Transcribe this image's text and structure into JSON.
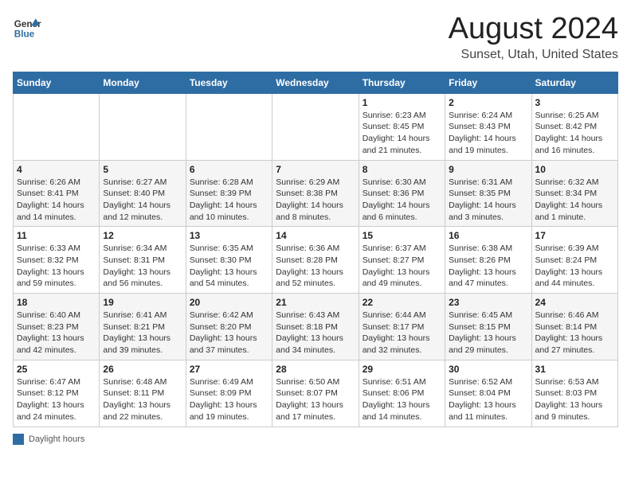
{
  "header": {
    "logo_general": "General",
    "logo_blue": "Blue",
    "title": "August 2024",
    "subtitle": "Sunset, Utah, United States"
  },
  "weekdays": [
    "Sunday",
    "Monday",
    "Tuesday",
    "Wednesday",
    "Thursday",
    "Friday",
    "Saturday"
  ],
  "legend": "Daylight hours",
  "weeks": [
    [
      {
        "day": "",
        "info": ""
      },
      {
        "day": "",
        "info": ""
      },
      {
        "day": "",
        "info": ""
      },
      {
        "day": "",
        "info": ""
      },
      {
        "day": "1",
        "info": "Sunrise: 6:23 AM\nSunset: 8:45 PM\nDaylight: 14 hours\nand 21 minutes."
      },
      {
        "day": "2",
        "info": "Sunrise: 6:24 AM\nSunset: 8:43 PM\nDaylight: 14 hours\nand 19 minutes."
      },
      {
        "day": "3",
        "info": "Sunrise: 6:25 AM\nSunset: 8:42 PM\nDaylight: 14 hours\nand 16 minutes."
      }
    ],
    [
      {
        "day": "4",
        "info": "Sunrise: 6:26 AM\nSunset: 8:41 PM\nDaylight: 14 hours\nand 14 minutes."
      },
      {
        "day": "5",
        "info": "Sunrise: 6:27 AM\nSunset: 8:40 PM\nDaylight: 14 hours\nand 12 minutes."
      },
      {
        "day": "6",
        "info": "Sunrise: 6:28 AM\nSunset: 8:39 PM\nDaylight: 14 hours\nand 10 minutes."
      },
      {
        "day": "7",
        "info": "Sunrise: 6:29 AM\nSunset: 8:38 PM\nDaylight: 14 hours\nand 8 minutes."
      },
      {
        "day": "8",
        "info": "Sunrise: 6:30 AM\nSunset: 8:36 PM\nDaylight: 14 hours\nand 6 minutes."
      },
      {
        "day": "9",
        "info": "Sunrise: 6:31 AM\nSunset: 8:35 PM\nDaylight: 14 hours\nand 3 minutes."
      },
      {
        "day": "10",
        "info": "Sunrise: 6:32 AM\nSunset: 8:34 PM\nDaylight: 14 hours\nand 1 minute."
      }
    ],
    [
      {
        "day": "11",
        "info": "Sunrise: 6:33 AM\nSunset: 8:32 PM\nDaylight: 13 hours\nand 59 minutes."
      },
      {
        "day": "12",
        "info": "Sunrise: 6:34 AM\nSunset: 8:31 PM\nDaylight: 13 hours\nand 56 minutes."
      },
      {
        "day": "13",
        "info": "Sunrise: 6:35 AM\nSunset: 8:30 PM\nDaylight: 13 hours\nand 54 minutes."
      },
      {
        "day": "14",
        "info": "Sunrise: 6:36 AM\nSunset: 8:28 PM\nDaylight: 13 hours\nand 52 minutes."
      },
      {
        "day": "15",
        "info": "Sunrise: 6:37 AM\nSunset: 8:27 PM\nDaylight: 13 hours\nand 49 minutes."
      },
      {
        "day": "16",
        "info": "Sunrise: 6:38 AM\nSunset: 8:26 PM\nDaylight: 13 hours\nand 47 minutes."
      },
      {
        "day": "17",
        "info": "Sunrise: 6:39 AM\nSunset: 8:24 PM\nDaylight: 13 hours\nand 44 minutes."
      }
    ],
    [
      {
        "day": "18",
        "info": "Sunrise: 6:40 AM\nSunset: 8:23 PM\nDaylight: 13 hours\nand 42 minutes."
      },
      {
        "day": "19",
        "info": "Sunrise: 6:41 AM\nSunset: 8:21 PM\nDaylight: 13 hours\nand 39 minutes."
      },
      {
        "day": "20",
        "info": "Sunrise: 6:42 AM\nSunset: 8:20 PM\nDaylight: 13 hours\nand 37 minutes."
      },
      {
        "day": "21",
        "info": "Sunrise: 6:43 AM\nSunset: 8:18 PM\nDaylight: 13 hours\nand 34 minutes."
      },
      {
        "day": "22",
        "info": "Sunrise: 6:44 AM\nSunset: 8:17 PM\nDaylight: 13 hours\nand 32 minutes."
      },
      {
        "day": "23",
        "info": "Sunrise: 6:45 AM\nSunset: 8:15 PM\nDaylight: 13 hours\nand 29 minutes."
      },
      {
        "day": "24",
        "info": "Sunrise: 6:46 AM\nSunset: 8:14 PM\nDaylight: 13 hours\nand 27 minutes."
      }
    ],
    [
      {
        "day": "25",
        "info": "Sunrise: 6:47 AM\nSunset: 8:12 PM\nDaylight: 13 hours\nand 24 minutes."
      },
      {
        "day": "26",
        "info": "Sunrise: 6:48 AM\nSunset: 8:11 PM\nDaylight: 13 hours\nand 22 minutes."
      },
      {
        "day": "27",
        "info": "Sunrise: 6:49 AM\nSunset: 8:09 PM\nDaylight: 13 hours\nand 19 minutes."
      },
      {
        "day": "28",
        "info": "Sunrise: 6:50 AM\nSunset: 8:07 PM\nDaylight: 13 hours\nand 17 minutes."
      },
      {
        "day": "29",
        "info": "Sunrise: 6:51 AM\nSunset: 8:06 PM\nDaylight: 13 hours\nand 14 minutes."
      },
      {
        "day": "30",
        "info": "Sunrise: 6:52 AM\nSunset: 8:04 PM\nDaylight: 13 hours\nand 11 minutes."
      },
      {
        "day": "31",
        "info": "Sunrise: 6:53 AM\nSunset: 8:03 PM\nDaylight: 13 hours\nand 9 minutes."
      }
    ]
  ]
}
